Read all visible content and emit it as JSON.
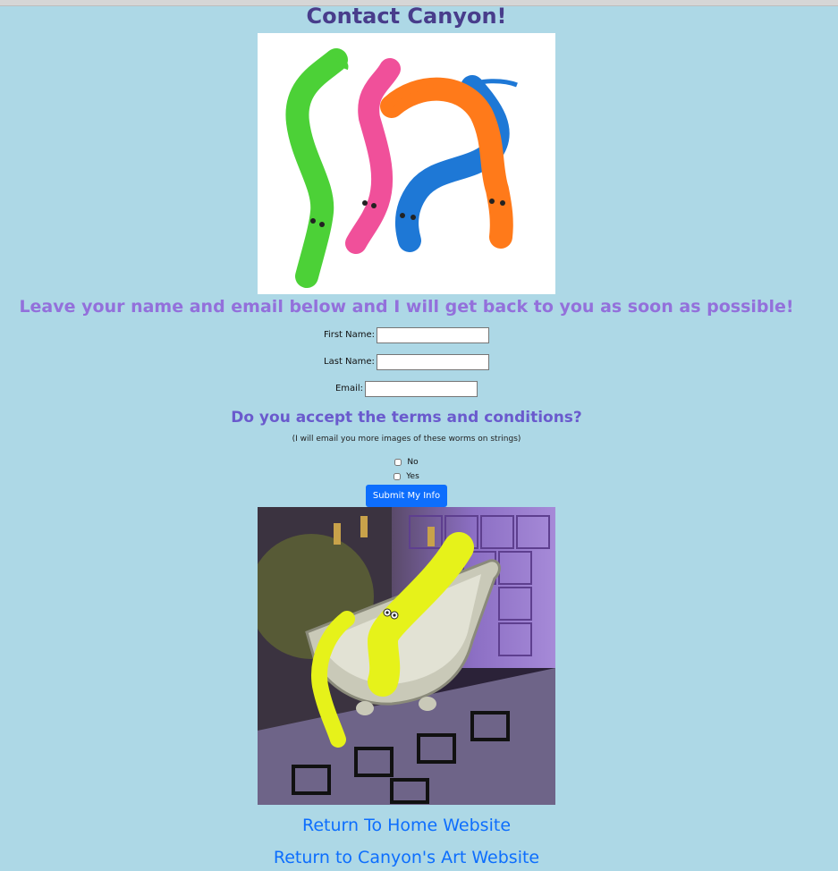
{
  "page": {
    "title": "Contact Canyon!",
    "subtitle": "Leave your name and email below and I will get back to you as soon as possible!"
  },
  "form": {
    "first_name_label": "First Name:",
    "first_name_value": "",
    "last_name_label": "Last Name:",
    "last_name_value": "",
    "email_label": "Email:",
    "email_value": "",
    "terms_question": "Do you accept the terms and conditions?",
    "terms_note": "(I will email you more images of these worms on strings)",
    "option_no": "No",
    "option_yes": "Yes",
    "submit_label": "Submit My Info"
  },
  "images": {
    "top_image": "worms-on-strings-photo",
    "bottom_image": "yellow-worm-bathtub-photo"
  },
  "links": {
    "home": "Return To Home Website",
    "art": "Return to Canyon's Art Website"
  },
  "colors": {
    "background": "#add8e6",
    "title": "#483d8b",
    "subtitle": "#9370db",
    "terms": "#6a5acd",
    "link": "#0d6efd",
    "button": "#0d6efd"
  }
}
